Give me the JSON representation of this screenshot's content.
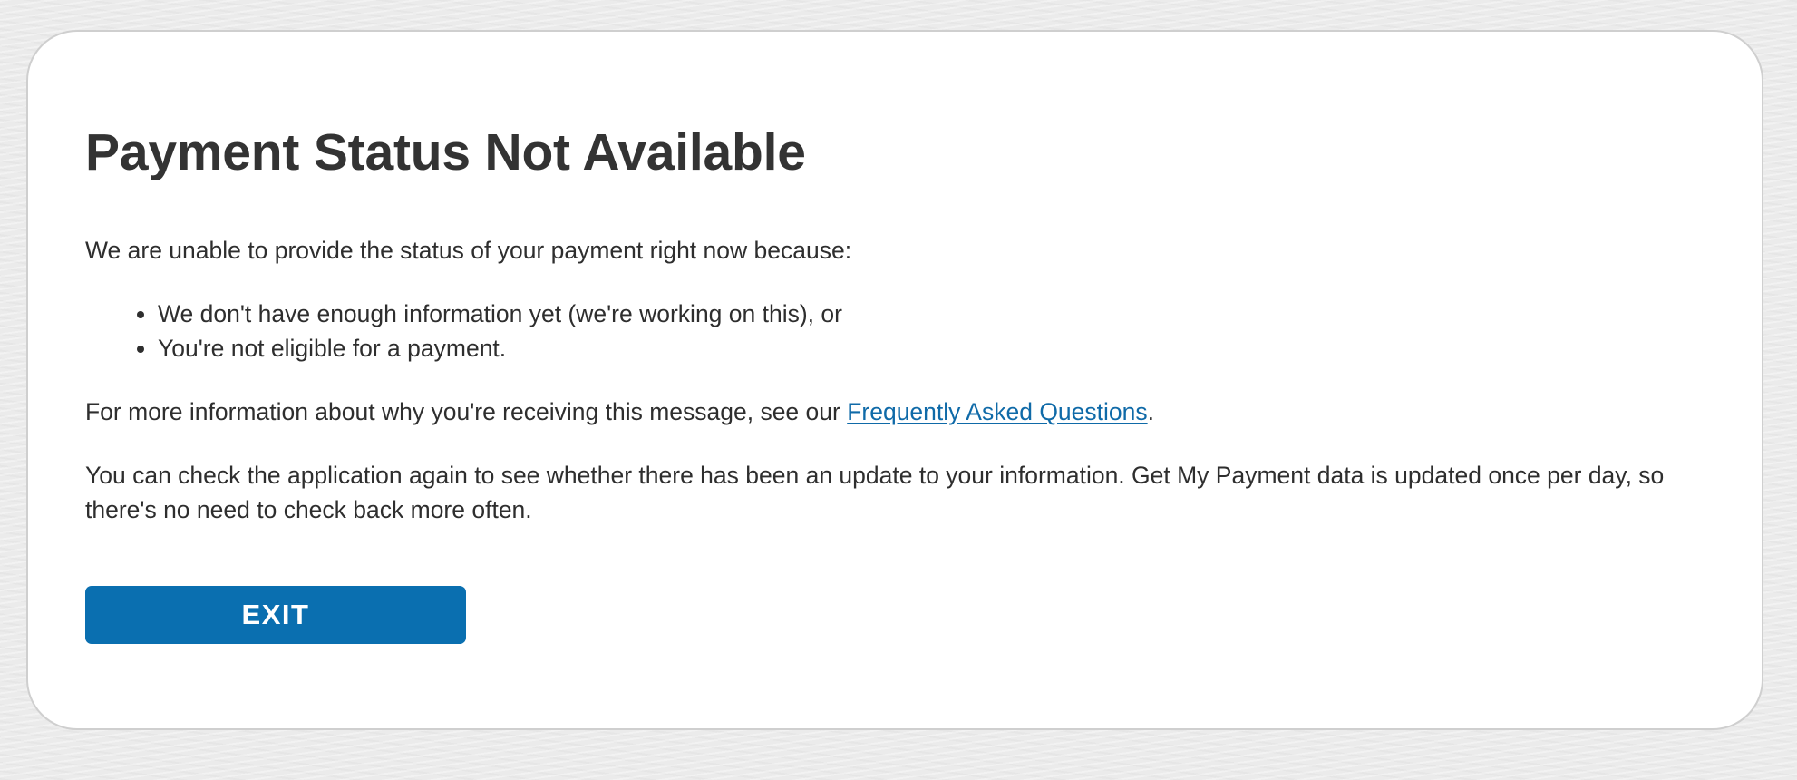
{
  "page": {
    "title": "Payment Status Not Available",
    "intro": "We are unable to provide the status of your payment right now because:",
    "reasons": [
      "We don't have enough information yet (we're working on this), or",
      "You're not eligible for a payment."
    ],
    "more_info": {
      "prefix": "For more information about why you're receiving this message, see our ",
      "link_text": "Frequently Asked Questions",
      "suffix": "."
    },
    "update_note": "You can check the application again to see whether there has been an update to your information. Get My Payment data is updated once per day, so there's no need to check back more often.",
    "exit_label": "EXIT"
  },
  "colors": {
    "accent": "#0a6fb0",
    "link": "#0f6aa8",
    "text": "#2e2e2e",
    "background": "#ebebeb"
  }
}
